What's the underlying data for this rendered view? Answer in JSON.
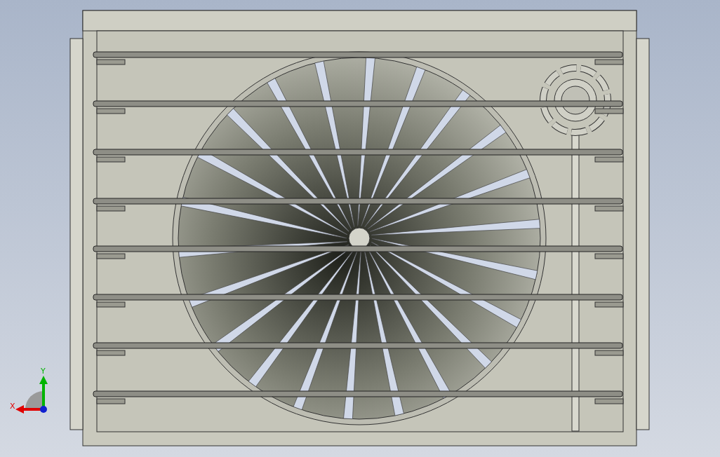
{
  "triad": {
    "axes": [
      {
        "label": "Y"
      },
      {
        "label": "X"
      }
    ]
  }
}
